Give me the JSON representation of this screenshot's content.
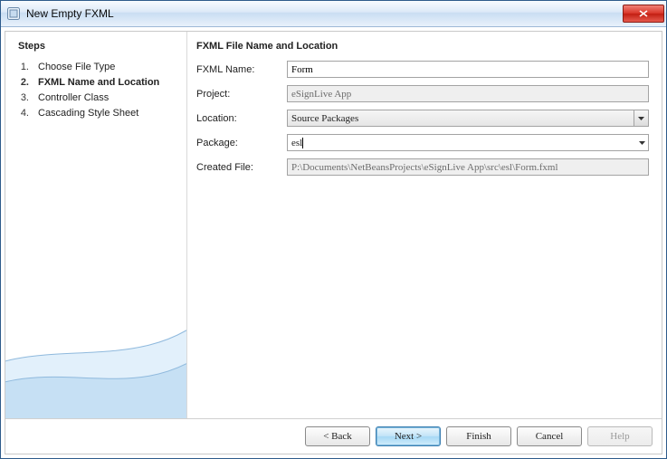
{
  "window": {
    "title": "New Empty FXML"
  },
  "left": {
    "heading": "Steps",
    "steps": [
      {
        "num": "1.",
        "label": "Choose File Type"
      },
      {
        "num": "2.",
        "label": "FXML Name and Location"
      },
      {
        "num": "3.",
        "label": "Controller Class"
      },
      {
        "num": "4.",
        "label": "Cascading Style Sheet"
      }
    ],
    "current_index": 1
  },
  "right": {
    "heading": "FXML File Name and Location",
    "labels": {
      "fxml_name": "FXML Name:",
      "project": "Project:",
      "location": "Location:",
      "package": "Package:",
      "created_file": "Created File:"
    },
    "values": {
      "fxml_name": "Form",
      "project": "eSignLive App",
      "location": "Source Packages",
      "package": "esl",
      "created_file": "P:\\Documents\\NetBeansProjects\\eSignLive App\\src\\esl\\Form.fxml"
    }
  },
  "footer": {
    "back": "< Back",
    "next": "Next >",
    "finish": "Finish",
    "cancel": "Cancel",
    "help": "Help"
  }
}
